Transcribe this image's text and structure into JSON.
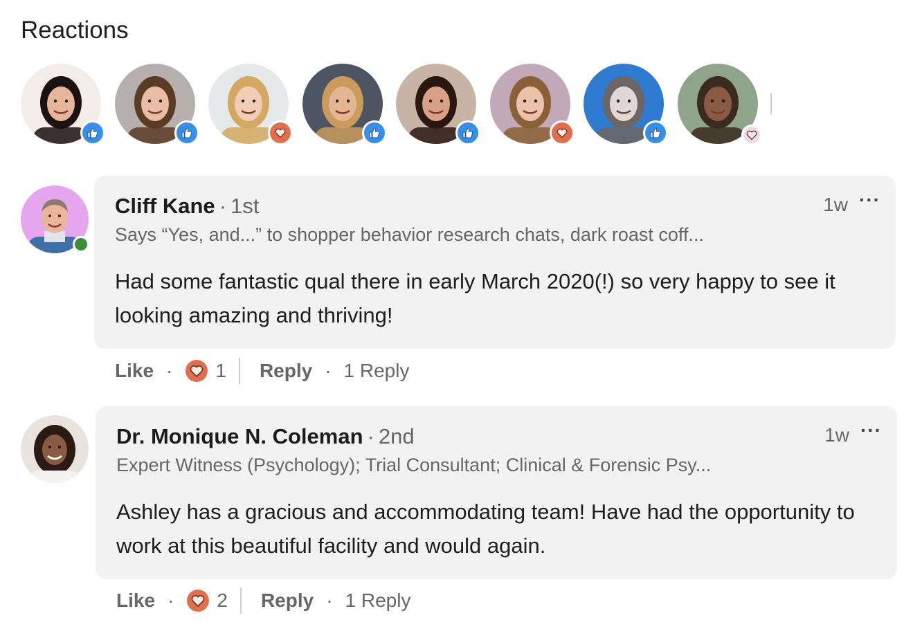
{
  "reactions": {
    "title": "Reactions",
    "reactors": [
      {
        "reaction": "like",
        "skin": "#e6b59a",
        "hair": "#1a1110",
        "bg": "#f3ece7"
      },
      {
        "reaction": "like",
        "skin": "#e7bda3",
        "hair": "#5a3b24",
        "bg": "#b5b0ad"
      },
      {
        "reaction": "love",
        "skin": "#f0cdb4",
        "hair": "#d3a860",
        "bg": "#e6e9ea"
      },
      {
        "reaction": "like",
        "skin": "#e3b592",
        "hair": "#c99c5c",
        "bg": "#4d5563"
      },
      {
        "reaction": "like",
        "skin": "#d8a185",
        "hair": "#2a1710",
        "bg": "#c7b4a5"
      },
      {
        "reaction": "love",
        "skin": "#ecc3aa",
        "hair": "#8a6136",
        "bg": "#c1a9b9"
      },
      {
        "reaction": "like",
        "skin": "#ded8d6",
        "hair": "#6d6563",
        "bg": "#2f7bd1"
      },
      {
        "reaction": "love",
        "skin": "#8a5a44",
        "hair": "#3a2a20",
        "bg": "#8fa48b"
      }
    ]
  },
  "colors": {
    "like": "#378fe9",
    "love": "#df704d",
    "presence": "#3c8c3a",
    "bubble": "#f2f2f2"
  },
  "comments": [
    {
      "name": "Cliff Kane",
      "degree": "1st",
      "headline": "Says “Yes, and...” to shopper behavior research chats, dark roast coff...",
      "time": "1w",
      "text": "Had some fantastic qual there in early March 2020(!) so very happy to see it looking amazing and thriving!",
      "like_label": "Like",
      "reaction_count": "1",
      "reply_label": "Reply",
      "replies_label": "1 Reply",
      "online": true
    },
    {
      "name": "Dr. Monique N. Coleman",
      "degree": "2nd",
      "headline": "Expert Witness (Psychology); Trial Consultant; Clinical & Forensic Psy...",
      "time": "1w",
      "text": "Ashley has a gracious and accommodating team! Have had the opportunity to work at this beautiful facility and would again.",
      "like_label": "Like",
      "reaction_count": "2",
      "reply_label": "Reply",
      "replies_label": "1 Reply",
      "online": false
    }
  ]
}
